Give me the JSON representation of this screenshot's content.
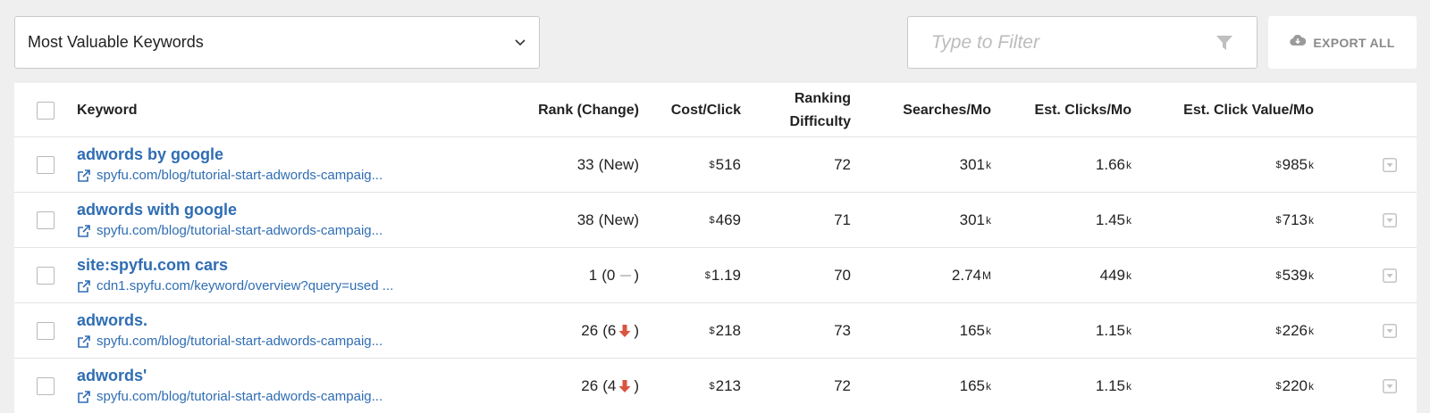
{
  "view_select": {
    "value": "Most Valuable Keywords"
  },
  "filter": {
    "placeholder": "Type to Filter"
  },
  "export": {
    "label": "EXPORT ALL"
  },
  "table": {
    "headers": {
      "keyword": "Keyword",
      "rank": "Rank (Change)",
      "cpc": "Cost/Click",
      "difficulty_line1": "Ranking",
      "difficulty_line2": "Difficulty",
      "searches": "Searches/Mo",
      "clicks": "Est. Clicks/Mo",
      "click_value": "Est. Click Value/Mo"
    },
    "rows": [
      {
        "keyword": "adwords by google",
        "url": "spyfu.com/blog/tutorial-start-adwords-campaig...",
        "rank": "33",
        "change": "New",
        "change_dir": "new",
        "cpc_num": "516",
        "difficulty": "72",
        "searches_num": "301",
        "searches_unit": "k",
        "clicks_num": "1.66",
        "clicks_unit": "k",
        "value_num": "985",
        "value_unit": "k"
      },
      {
        "keyword": "adwords with google",
        "url": "spyfu.com/blog/tutorial-start-adwords-campaig...",
        "rank": "38",
        "change": "New",
        "change_dir": "new",
        "cpc_num": "469",
        "difficulty": "71",
        "searches_num": "301",
        "searches_unit": "k",
        "clicks_num": "1.45",
        "clicks_unit": "k",
        "value_num": "713",
        "value_unit": "k"
      },
      {
        "keyword": "site:spyfu.com cars",
        "url": "cdn1.spyfu.com/keyword/overview?query=used ...",
        "rank": "1",
        "change": "0",
        "change_dir": "none",
        "cpc_num": "1.19",
        "difficulty": "70",
        "searches_num": "2.74",
        "searches_unit": "M",
        "clicks_num": "449",
        "clicks_unit": "k",
        "value_num": "539",
        "value_unit": "k"
      },
      {
        "keyword": "adwords.",
        "url": "spyfu.com/blog/tutorial-start-adwords-campaig...",
        "rank": "26",
        "change": "6",
        "change_dir": "down",
        "cpc_num": "218",
        "difficulty": "73",
        "searches_num": "165",
        "searches_unit": "k",
        "clicks_num": "1.15",
        "clicks_unit": "k",
        "value_num": "226",
        "value_unit": "k"
      },
      {
        "keyword": "adwords'",
        "url": "spyfu.com/blog/tutorial-start-adwords-campaig...",
        "rank": "26",
        "change": "4",
        "change_dir": "down",
        "cpc_num": "213",
        "difficulty": "72",
        "searches_num": "165",
        "searches_unit": "k",
        "clicks_num": "1.15",
        "clicks_unit": "k",
        "value_num": "220",
        "value_unit": "k"
      }
    ]
  },
  "currency_symbol": "$",
  "colors": {
    "link": "#2f6db3",
    "down_arrow": "#d9553f"
  },
  "icons": {
    "dropdown": "chevron-down-icon",
    "filter": "funnel-icon",
    "export": "cloud-download-icon",
    "link": "external-link-icon",
    "row_menu": "caret-box-icon"
  }
}
